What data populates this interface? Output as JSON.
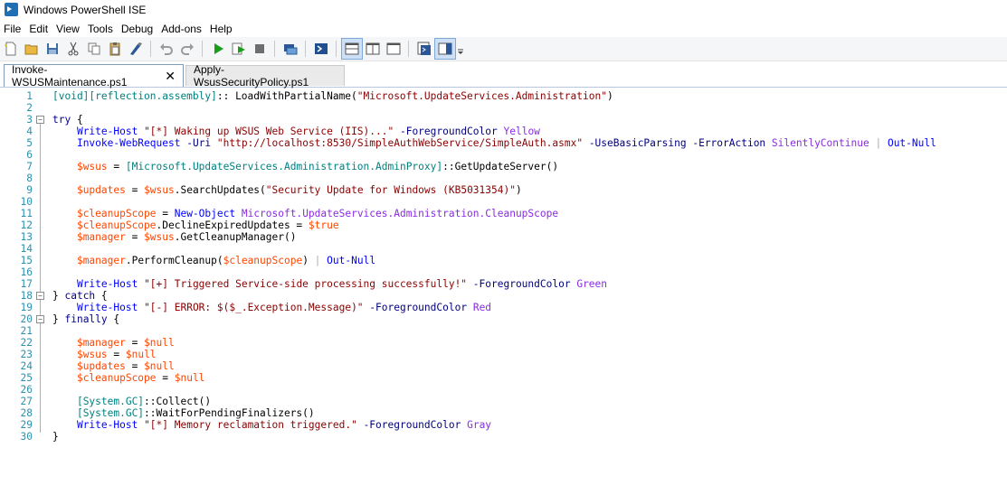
{
  "window": {
    "title": "Windows PowerShell ISE"
  },
  "menu": [
    "File",
    "Edit",
    "View",
    "Tools",
    "Debug",
    "Add-ons",
    "Help"
  ],
  "toolbar": [
    {
      "name": "new-icon",
      "group": 1
    },
    {
      "name": "open-icon",
      "group": 1
    },
    {
      "name": "save-icon",
      "group": 1
    },
    {
      "name": "cut-icon",
      "group": 2
    },
    {
      "name": "copy-icon",
      "group": 2
    },
    {
      "name": "paste-icon",
      "group": 2
    },
    {
      "name": "clear-console-icon",
      "group": 2
    },
    {
      "name": "undo-icon",
      "group": 3
    },
    {
      "name": "redo-icon",
      "group": 3
    },
    {
      "name": "run-icon",
      "group": 4
    },
    {
      "name": "run-selection-icon",
      "group": 4
    },
    {
      "name": "stop-icon",
      "group": 4
    },
    {
      "name": "remote-tab-icon",
      "group": 5
    },
    {
      "name": "powershell-console-icon",
      "group": 6
    },
    {
      "name": "show-script-pane-top-icon",
      "group": 7
    },
    {
      "name": "show-script-pane-right-icon",
      "group": 7
    },
    {
      "name": "show-script-pane-max-icon",
      "group": 7
    },
    {
      "name": "command-window-icon",
      "group": 8
    },
    {
      "name": "command-addon-icon",
      "group": 8
    }
  ],
  "tabs": [
    {
      "label": "Invoke-WSUSMaintenance.ps1",
      "active": true,
      "close": "✕"
    },
    {
      "label": "Apply-WsusSecurityPolicy.ps1",
      "active": false
    }
  ],
  "colors": {
    "keyword": "#00008b",
    "command": "#0000ff",
    "variable": "#ff4500",
    "string": "#8b0000",
    "type": "#008080",
    "parameter": "#000080",
    "value": "#8a2be2",
    "linenumber": "#2b91af"
  },
  "code_lines": [
    [
      [
        "typ",
        "[void][reflection.assembly]"
      ],
      [
        "",
        ":: LoadWithPartialName("
      ],
      [
        "str",
        "\"Microsoft.UpdateServices.Administration\""
      ],
      [
        "",
        ")"
      ]
    ],
    [],
    [
      [
        "kw",
        "try"
      ],
      [
        "",
        " {"
      ]
    ],
    [
      [
        "",
        "    "
      ],
      [
        "cmd",
        "Write-Host"
      ],
      [
        "",
        " "
      ],
      [
        "str",
        "\"[*] Waking up WSUS Web Service (IIS)...\""
      ],
      [
        "",
        " "
      ],
      [
        "par",
        "-ForegroundColor"
      ],
      [
        "",
        " "
      ],
      [
        "val",
        "Yellow"
      ]
    ],
    [
      [
        "",
        "    "
      ],
      [
        "cmd",
        "Invoke-WebRequest"
      ],
      [
        "",
        " "
      ],
      [
        "par",
        "-Uri"
      ],
      [
        "",
        " "
      ],
      [
        "str",
        "\"http://localhost:8530/SimpleAuthWebService/SimpleAuth.asmx\""
      ],
      [
        "",
        " "
      ],
      [
        "par",
        "-UseBasicParsing"
      ],
      [
        "",
        " "
      ],
      [
        "par",
        "-ErrorAction"
      ],
      [
        "",
        " "
      ],
      [
        "val",
        "SilentlyContinue"
      ],
      [
        "",
        " "
      ],
      [
        "op",
        "|"
      ],
      [
        "",
        " "
      ],
      [
        "cmd",
        "Out-Null"
      ]
    ],
    [],
    [
      [
        "",
        "    "
      ],
      [
        "var",
        "$wsus"
      ],
      [
        "",
        " = "
      ],
      [
        "typ",
        "[Microsoft.UpdateServices.Administration.AdminProxy]"
      ],
      [
        "",
        "::GetUpdateServer()"
      ]
    ],
    [],
    [
      [
        "",
        "    "
      ],
      [
        "var",
        "$updates"
      ],
      [
        "",
        " = "
      ],
      [
        "var",
        "$wsus"
      ],
      [
        "",
        ".SearchUpdates("
      ],
      [
        "str",
        "\"Security Update for Windows (KB5031354)\""
      ],
      [
        "",
        ")"
      ]
    ],
    [],
    [
      [
        "",
        "    "
      ],
      [
        "var",
        "$cleanupScope"
      ],
      [
        "",
        " = "
      ],
      [
        "cmd",
        "New-Object"
      ],
      [
        "",
        " "
      ],
      [
        "val",
        "Microsoft.UpdateServices.Administration.CleanupScope"
      ]
    ],
    [
      [
        "",
        "    "
      ],
      [
        "var",
        "$cleanupScope"
      ],
      [
        "",
        ".DeclineExpiredUpdates = "
      ],
      [
        "var",
        "$true"
      ]
    ],
    [
      [
        "",
        "    "
      ],
      [
        "var",
        "$manager"
      ],
      [
        "",
        " = "
      ],
      [
        "var",
        "$wsus"
      ],
      [
        "",
        ".GetCleanupManager()"
      ]
    ],
    [],
    [
      [
        "",
        "    "
      ],
      [
        "var",
        "$manager"
      ],
      [
        "",
        ".PerformCleanup("
      ],
      [
        "var",
        "$cleanupScope"
      ],
      [
        "",
        ") "
      ],
      [
        "op",
        "|"
      ],
      [
        "",
        " "
      ],
      [
        "cmd",
        "Out-Null"
      ]
    ],
    [],
    [
      [
        "",
        "    "
      ],
      [
        "cmd",
        "Write-Host"
      ],
      [
        "",
        " "
      ],
      [
        "str",
        "\"[+] Triggered Service-side processing successfully!\""
      ],
      [
        "",
        " "
      ],
      [
        "par",
        "-ForegroundColor"
      ],
      [
        "",
        " "
      ],
      [
        "val",
        "Green"
      ]
    ],
    [
      [
        "",
        "} "
      ],
      [
        "kw",
        "catch"
      ],
      [
        "",
        " {"
      ]
    ],
    [
      [
        "",
        "    "
      ],
      [
        "cmd",
        "Write-Host"
      ],
      [
        "",
        " "
      ],
      [
        "str",
        "\"[-] ERROR: $($_.Exception.Message)\""
      ],
      [
        "",
        " "
      ],
      [
        "par",
        "-ForegroundColor"
      ],
      [
        "",
        " "
      ],
      [
        "val",
        "Red"
      ]
    ],
    [
      [
        "",
        "} "
      ],
      [
        "kw",
        "finally"
      ],
      [
        "",
        " {"
      ]
    ],
    [],
    [
      [
        "",
        "    "
      ],
      [
        "var",
        "$manager"
      ],
      [
        "",
        " = "
      ],
      [
        "var",
        "$null"
      ]
    ],
    [
      [
        "",
        "    "
      ],
      [
        "var",
        "$wsus"
      ],
      [
        "",
        " = "
      ],
      [
        "var",
        "$null"
      ]
    ],
    [
      [
        "",
        "    "
      ],
      [
        "var",
        "$updates"
      ],
      [
        "",
        " = "
      ],
      [
        "var",
        "$null"
      ]
    ],
    [
      [
        "",
        "    "
      ],
      [
        "var",
        "$cleanupScope"
      ],
      [
        "",
        " = "
      ],
      [
        "var",
        "$null"
      ]
    ],
    [],
    [
      [
        "",
        "    "
      ],
      [
        "typ",
        "[System.GC]"
      ],
      [
        "",
        "::Collect()"
      ]
    ],
    [
      [
        "",
        "    "
      ],
      [
        "typ",
        "[System.GC]"
      ],
      [
        "",
        "::WaitForPendingFinalizers()"
      ]
    ],
    [
      [
        "",
        "    "
      ],
      [
        "cmd",
        "Write-Host"
      ],
      [
        "",
        " "
      ],
      [
        "str",
        "\"[*] Memory reclamation triggered.\""
      ],
      [
        "",
        " "
      ],
      [
        "par",
        "-ForegroundColor"
      ],
      [
        "",
        " "
      ],
      [
        "val",
        "Gray"
      ]
    ],
    [
      [
        "",
        "}"
      ]
    ]
  ],
  "folds": [
    3,
    18,
    20
  ]
}
